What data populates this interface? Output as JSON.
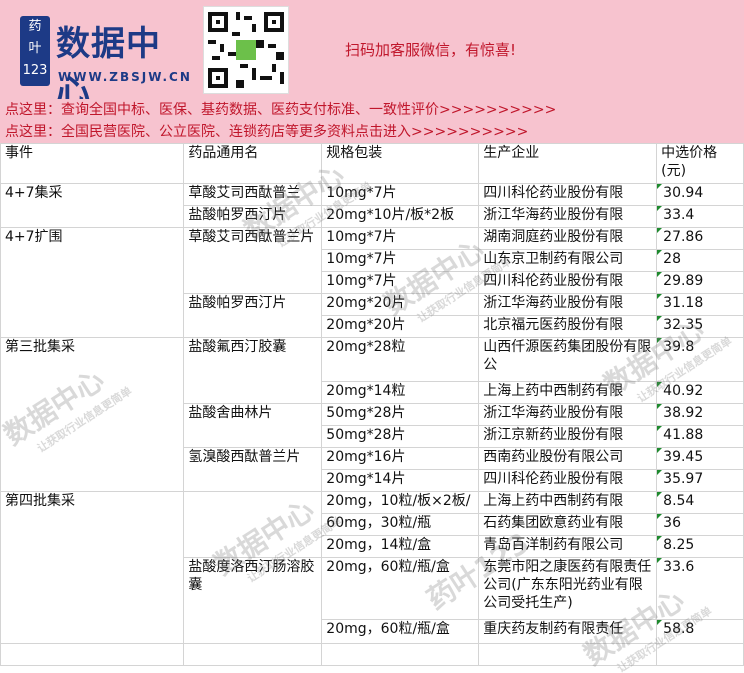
{
  "banner": {
    "logo_badge": "药\n叶\n123",
    "logo_title": "数据中心",
    "logo_url": "WWW.ZBSJW.CN",
    "message": "扫码加客服微信，有惊喜!"
  },
  "links": [
    "点这里：查询全国中标、医保、基药数据、医药支付标准、一致性评价>>>>>>>>>>",
    "点这里：全国民营医院、公立医院、连锁药店等更多资料点击进入>>>>>>>>>>"
  ],
  "table": {
    "headers": [
      "事件",
      "药品通用名",
      "规格包装",
      "生产企业",
      "中选价格(元)"
    ],
    "rows": [
      {
        "event": "4+7集采",
        "drug": "草酸艾司西酞普兰",
        "spec": "10mg*7片",
        "company": "四川科伦药业股份有限",
        "price": "30.94"
      },
      {
        "event": "",
        "drug": "盐酸帕罗西汀片",
        "spec": "20mg*10片/板*2板",
        "company": "浙江华海药业股份有限",
        "price": "33.4"
      },
      {
        "event": "4+7扩围",
        "drug": "草酸艾司西酞普兰片",
        "spec": "10mg*7片",
        "company": "湖南洞庭药业股份有限",
        "price": "27.86"
      },
      {
        "event": "",
        "drug": "",
        "spec": "10mg*7片",
        "company": "山东京卫制药有限公司",
        "price": "28"
      },
      {
        "event": "",
        "drug": "",
        "spec": "10mg*7片",
        "company": "四川科伦药业股份有限",
        "price": "29.89"
      },
      {
        "event": "",
        "drug": "盐酸帕罗西汀片",
        "spec": "20mg*20片",
        "company": "浙江华海药业股份有限",
        "price": "31.18"
      },
      {
        "event": "",
        "drug": "",
        "spec": "20mg*20片",
        "company": "北京福元医药股份有限",
        "price": "32.35"
      },
      {
        "event": "第三批集采",
        "drug": "盐酸氟西汀胶囊",
        "spec": "20mg*28粒",
        "company": "山西仟源医药集团股份有限公",
        "price": "39.8"
      },
      {
        "event": "",
        "drug": "",
        "spec": "20mg*14粒",
        "company": "上海上药中西制药有限",
        "price": "40.92"
      },
      {
        "event": "",
        "drug": "盐酸舍曲林片",
        "spec": "50mg*28片",
        "company": "浙江华海药业股份有限",
        "price": "38.92"
      },
      {
        "event": "",
        "drug": "",
        "spec": "50mg*28片",
        "company": "浙江京新药业股份有限",
        "price": "41.88"
      },
      {
        "event": "",
        "drug": "氢溴酸西酞普兰片",
        "spec": "20mg*16片",
        "company": "西南药业股份有限公司",
        "price": "39.45"
      },
      {
        "event": "",
        "drug": "",
        "spec": "20mg*14片",
        "company": "四川科伦药业股份有限",
        "price": "35.97"
      },
      {
        "event": "第四批集采",
        "drug": "",
        "spec": "20mg，10粒/板×2板/",
        "company": "上海上药中西制药有限",
        "price": "8.54"
      },
      {
        "event": "",
        "drug": "",
        "spec": "60mg，30粒/瓶",
        "company": "石药集团欧意药业有限",
        "price": "36"
      },
      {
        "event": "",
        "drug": "",
        "spec": "20mg，14粒/盒",
        "company": "青岛百洋制药有限公司",
        "price": "8.25"
      },
      {
        "event": "",
        "drug": "盐酸度洛西汀肠溶胶囊",
        "spec": "20mg，60粒/瓶/盒",
        "company": "东莞市阳之康医药有限责任公司(广东东阳光药业有限公司受托生产)",
        "price": "33.6"
      },
      {
        "event": "",
        "drug": "",
        "spec": "20mg，60粒/瓶/盒",
        "company": "重庆药友制药有限责任",
        "price": "58.8"
      }
    ]
  },
  "watermark": {
    "title": "数据中心",
    "url": "ZBSJW.CN",
    "slogan": "让获取行业信息更简单",
    "badge": "药叶123"
  }
}
